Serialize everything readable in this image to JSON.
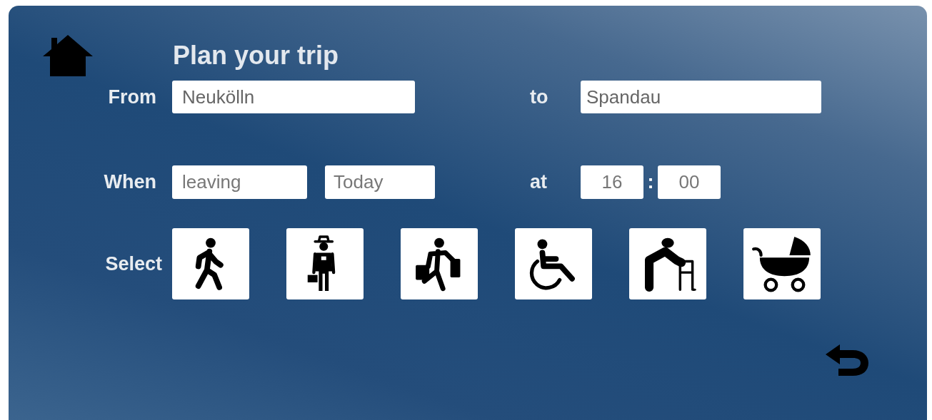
{
  "title": "Plan your trip",
  "from": {
    "label": "From",
    "value": "Neukölln"
  },
  "to": {
    "label": "to",
    "value": "Spandau"
  },
  "when": {
    "label": "When",
    "mode": "leaving",
    "day": "Today"
  },
  "at": {
    "label": "at",
    "hour": "16",
    "separator": ":",
    "minute": "00"
  },
  "select": {
    "label": "Select",
    "options": [
      {
        "kind": "walker"
      },
      {
        "kind": "worker"
      },
      {
        "kind": "shopper"
      },
      {
        "kind": "wheelchair"
      },
      {
        "kind": "frame"
      },
      {
        "kind": "pram"
      }
    ]
  }
}
